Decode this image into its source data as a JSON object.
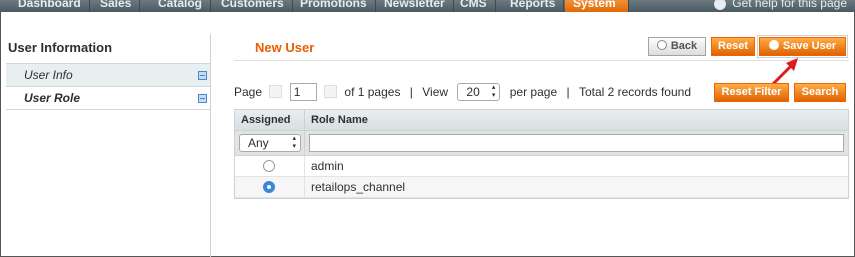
{
  "topnav": {
    "tabs": [
      "Dashboard",
      "Sales",
      "Catalog",
      "Customers",
      "Promotions",
      "Newsletter",
      "CMS",
      "Reports",
      "System"
    ],
    "active": "System",
    "help": "Get help for this page"
  },
  "sidebar": {
    "title": "User Information",
    "items": [
      {
        "label": "User Info"
      },
      {
        "label": "User Role"
      }
    ]
  },
  "main": {
    "title": "New User",
    "buttons": {
      "back": "Back",
      "reset": "Reset",
      "save": "Save User",
      "reset_filter": "Reset Filter",
      "search": "Search"
    }
  },
  "pager": {
    "page_label": "Page",
    "page_value": "1",
    "of_pages": "of 1 pages",
    "sep1": "|",
    "view_label": "View",
    "view_value": "20",
    "per_page": "per page",
    "sep2": "|",
    "records": "Total 2 records found"
  },
  "grid": {
    "headers": {
      "assigned": "Assigned",
      "role_name": "Role Name"
    },
    "filter": {
      "assigned": "Any"
    },
    "rows": [
      {
        "role_name": "admin",
        "checked": false
      },
      {
        "role_name": "retailops_channel",
        "checked": true
      }
    ]
  },
  "colors": {
    "accent": "#eb5e00",
    "button": "#f18200",
    "annotation": "#e01b1b"
  }
}
